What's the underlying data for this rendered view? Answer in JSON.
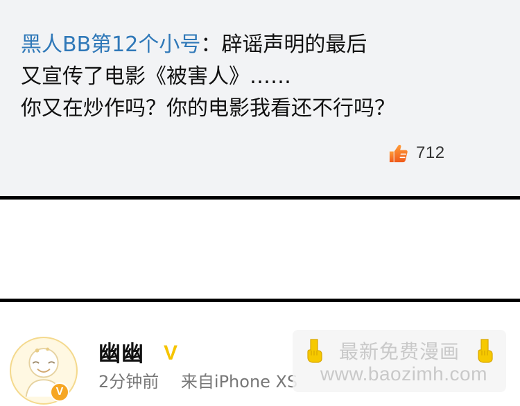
{
  "comment": {
    "author": "黑人BB第12个小号",
    "separator": "：",
    "line1": "辟谣声明的最后",
    "line2": "又宣传了电影《被害人》……",
    "line3": "你又在炒作吗？你的电影我看还不行吗？",
    "like_icon": "thumbs-up-icon",
    "like_count": "712"
  },
  "user": {
    "name": "幽幽",
    "verified_mark": "V",
    "time": "2分钟前",
    "source": "来自iPhone XS",
    "avatar_icon": "default-avatar-icon",
    "badge_mark": "V"
  },
  "watermark": {
    "title": "最新免费漫画",
    "url": "www.baozimh.com",
    "hand_icon": "pointing-down-hand-icon"
  },
  "colors": {
    "author_blue": "#2f78b8",
    "panel_gray": "#f2f3f5",
    "divider_black": "#000000",
    "verified_yellow": "#f6c400",
    "badge_orange": "#f6a623",
    "meta_gray": "#777777"
  }
}
